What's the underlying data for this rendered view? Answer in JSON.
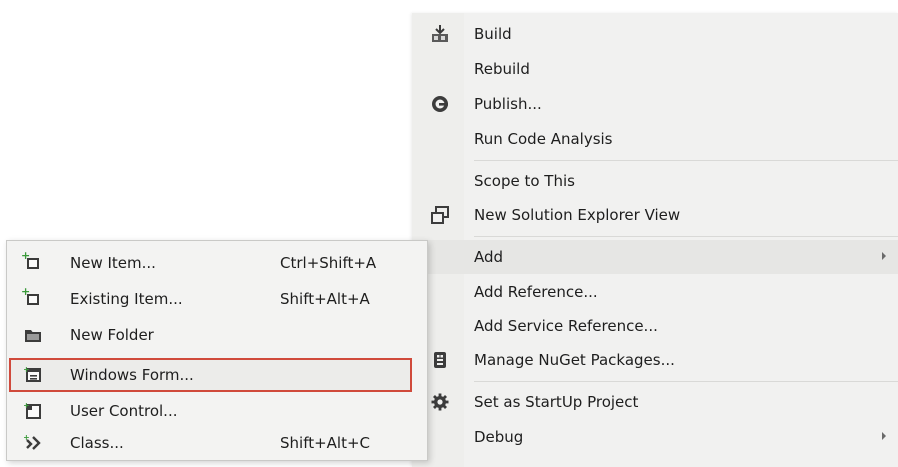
{
  "main_menu": {
    "items": [
      {
        "label": "Build",
        "icon": "build-icon"
      },
      {
        "label": "Rebuild",
        "icon": ""
      },
      {
        "label": "Publish...",
        "icon": "publish-icon"
      },
      {
        "label": "Run Code Analysis",
        "icon": ""
      },
      {
        "label": "Scope to This",
        "icon": ""
      },
      {
        "label": "New Solution Explorer View",
        "icon": "solution-explorer-icon"
      },
      {
        "label": "Add",
        "icon": "",
        "has_submenu": true
      },
      {
        "label": "Add Reference...",
        "icon": ""
      },
      {
        "label": "Add Service Reference...",
        "icon": ""
      },
      {
        "label": "Manage NuGet Packages...",
        "icon": "nuget-icon"
      },
      {
        "label": "Set as StartUp Project",
        "icon": "gear-icon"
      },
      {
        "label": "Debug",
        "icon": "",
        "has_submenu": true
      }
    ]
  },
  "add_submenu": {
    "items": [
      {
        "label": "New Item...",
        "shortcut": "Ctrl+Shift+A",
        "icon": "new-item-icon"
      },
      {
        "label": "Existing Item...",
        "shortcut": "Shift+Alt+A",
        "icon": "existing-item-icon"
      },
      {
        "label": "New Folder",
        "shortcut": "",
        "icon": "folder-icon"
      },
      {
        "label": "Windows Form...",
        "shortcut": "",
        "icon": "windows-form-icon",
        "highlighted": true
      },
      {
        "label": "User Control...",
        "shortcut": "",
        "icon": "user-control-icon"
      },
      {
        "label": "Class...",
        "shortcut": "Shift+Alt+C",
        "icon": "class-icon"
      }
    ]
  },
  "colors": {
    "highlight_border": "#d04a3c",
    "menu_background": "#f1f1f0",
    "text": "#1e1e1e"
  }
}
